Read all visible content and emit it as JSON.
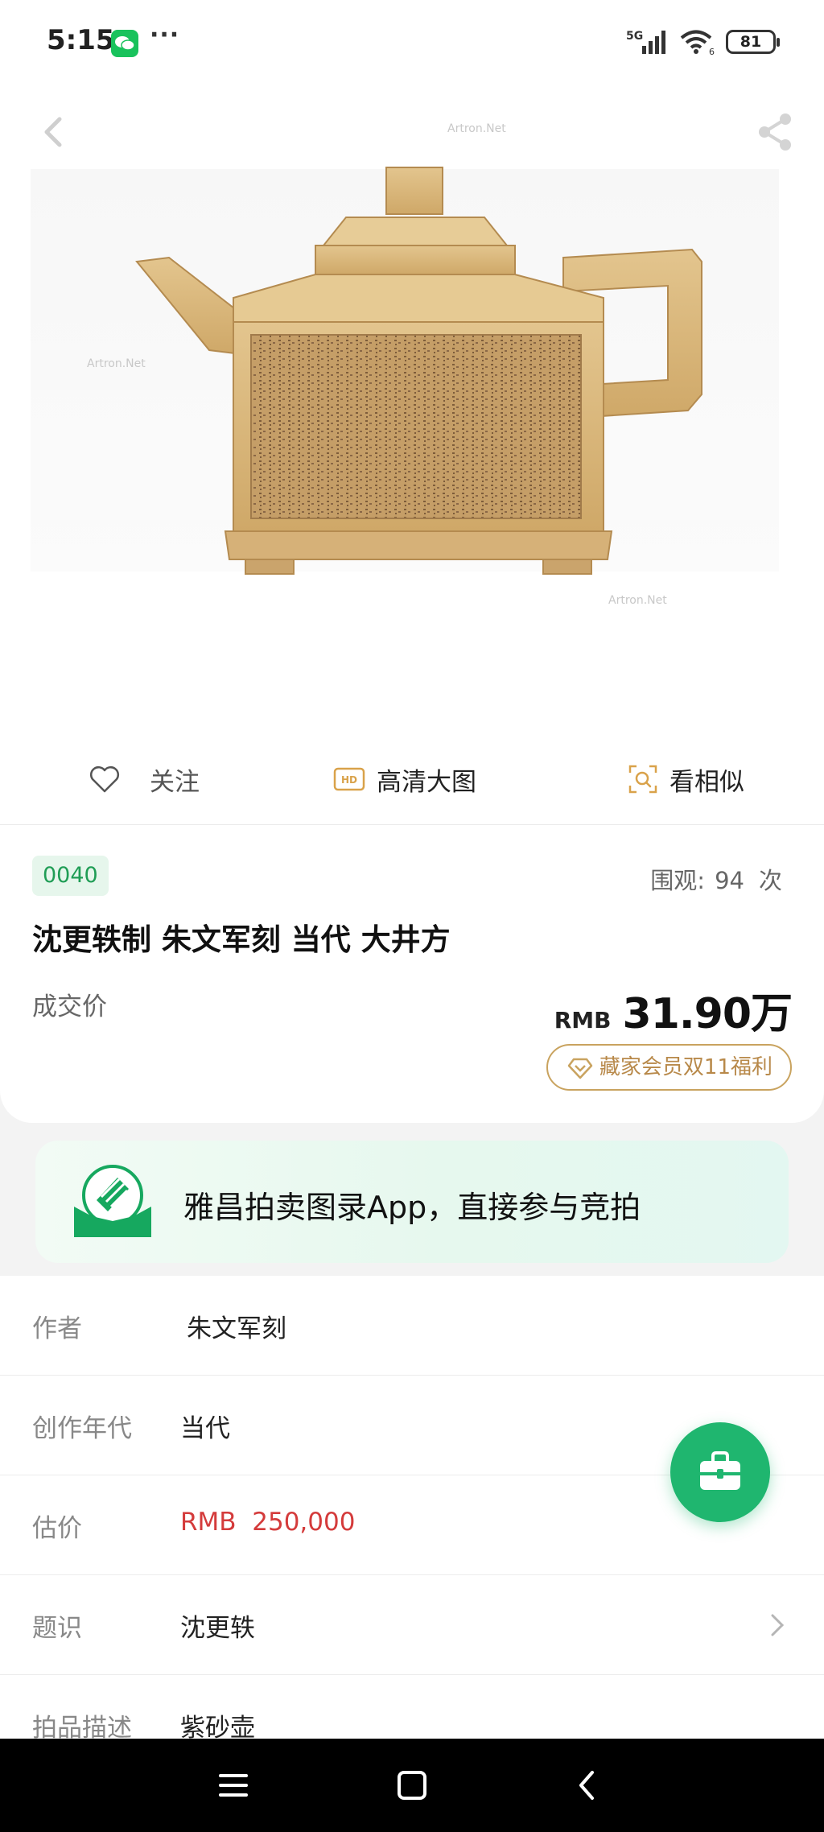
{
  "status_bar": {
    "time": "5:15",
    "dots": "···",
    "network": "5G",
    "wifi_level": "6",
    "battery": "81"
  },
  "hero": {
    "watermark": "Artron.Net",
    "icons": [
      "back-icon",
      "share-icon"
    ]
  },
  "actions": {
    "follow_label": "关注",
    "hd_badge": "HD",
    "hd_label": "高清大图",
    "similar_label": "看相似"
  },
  "lot": {
    "number": "0040",
    "views_label": "围观:",
    "views_count": "94",
    "views_unit": "次",
    "title": "沈更轶制 朱文军刻 当代 大井方",
    "price_label": "成交价",
    "price_currency": "RMB",
    "price_amount": "31.90万",
    "member_promo": "藏家会员双11福利"
  },
  "promo": {
    "text": "雅昌拍卖图录App，直接参与竞拍"
  },
  "details": [
    {
      "label": "作者",
      "value": "朱文军刻"
    },
    {
      "label": "创作年代",
      "value": "当代"
    },
    {
      "label": "估价",
      "value": "RMB  250,000"
    },
    {
      "label": "题识",
      "value": "沈更轶"
    },
    {
      "label": "拍品描述",
      "value": "紫砂壶"
    }
  ],
  "colors": {
    "accent": "#1fb66f",
    "estimate": "#d43b3b",
    "member_gold": "#b8894a",
    "lot_badge": "#1f9d55"
  }
}
